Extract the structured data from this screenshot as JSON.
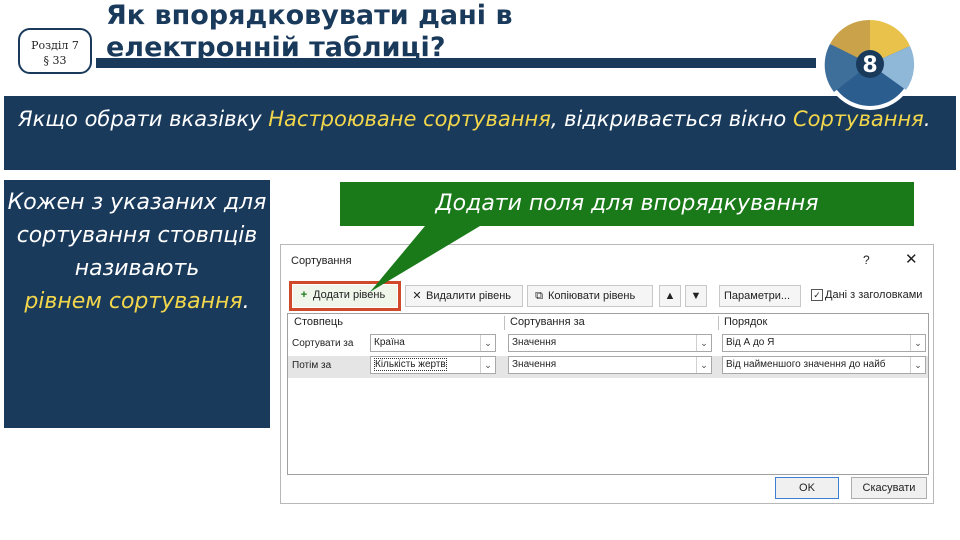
{
  "header": {
    "badge_line1": "Розділ 7",
    "badge_line2": "§ 33",
    "title_line1": "Як впорядковувати дані в",
    "title_line2": "електронній таблиці?",
    "logo_number": "8"
  },
  "info": {
    "part1": "Якщо обрати вказівку ",
    "highlight1": "Настроюване сортування",
    "part2": ", відкривається вікно ",
    "highlight2": "Сортування",
    "part3": "."
  },
  "left_panel": {
    "text": "Кожен з указаних для сортування стовпців називають",
    "highlight": "рівнем сортування",
    "end": "."
  },
  "callout": {
    "text": "Додати поля для впорядкування"
  },
  "dialog": {
    "title": "Сортування",
    "help": "?",
    "close": "✕",
    "toolbar": {
      "add_level": "Додати рівень",
      "delete_level": "Видалити рівень",
      "copy_level": "Копіювати рівень",
      "parameters": "Параметри...",
      "headers_checkbox": "Дані з заголовками"
    },
    "columns": {
      "column": "Стовпець",
      "sort_on": "Сортування за",
      "order": "Порядок"
    },
    "rows": [
      {
        "label": "Сортувати за",
        "column": "Країна",
        "sort_on": "Значення",
        "order": "Від А до Я"
      },
      {
        "label": "Потім за",
        "column": "Кількість жертв",
        "sort_on": "Значення",
        "order": "Від найменшого значення до найб"
      }
    ],
    "ok": "OK",
    "cancel": "Скасувати"
  },
  "colors": {
    "navy": "#1a3a5c",
    "highlight_yellow": "#f2d64b",
    "callout_green": "#1a7a1a",
    "red_frame": "#d04a2a"
  }
}
